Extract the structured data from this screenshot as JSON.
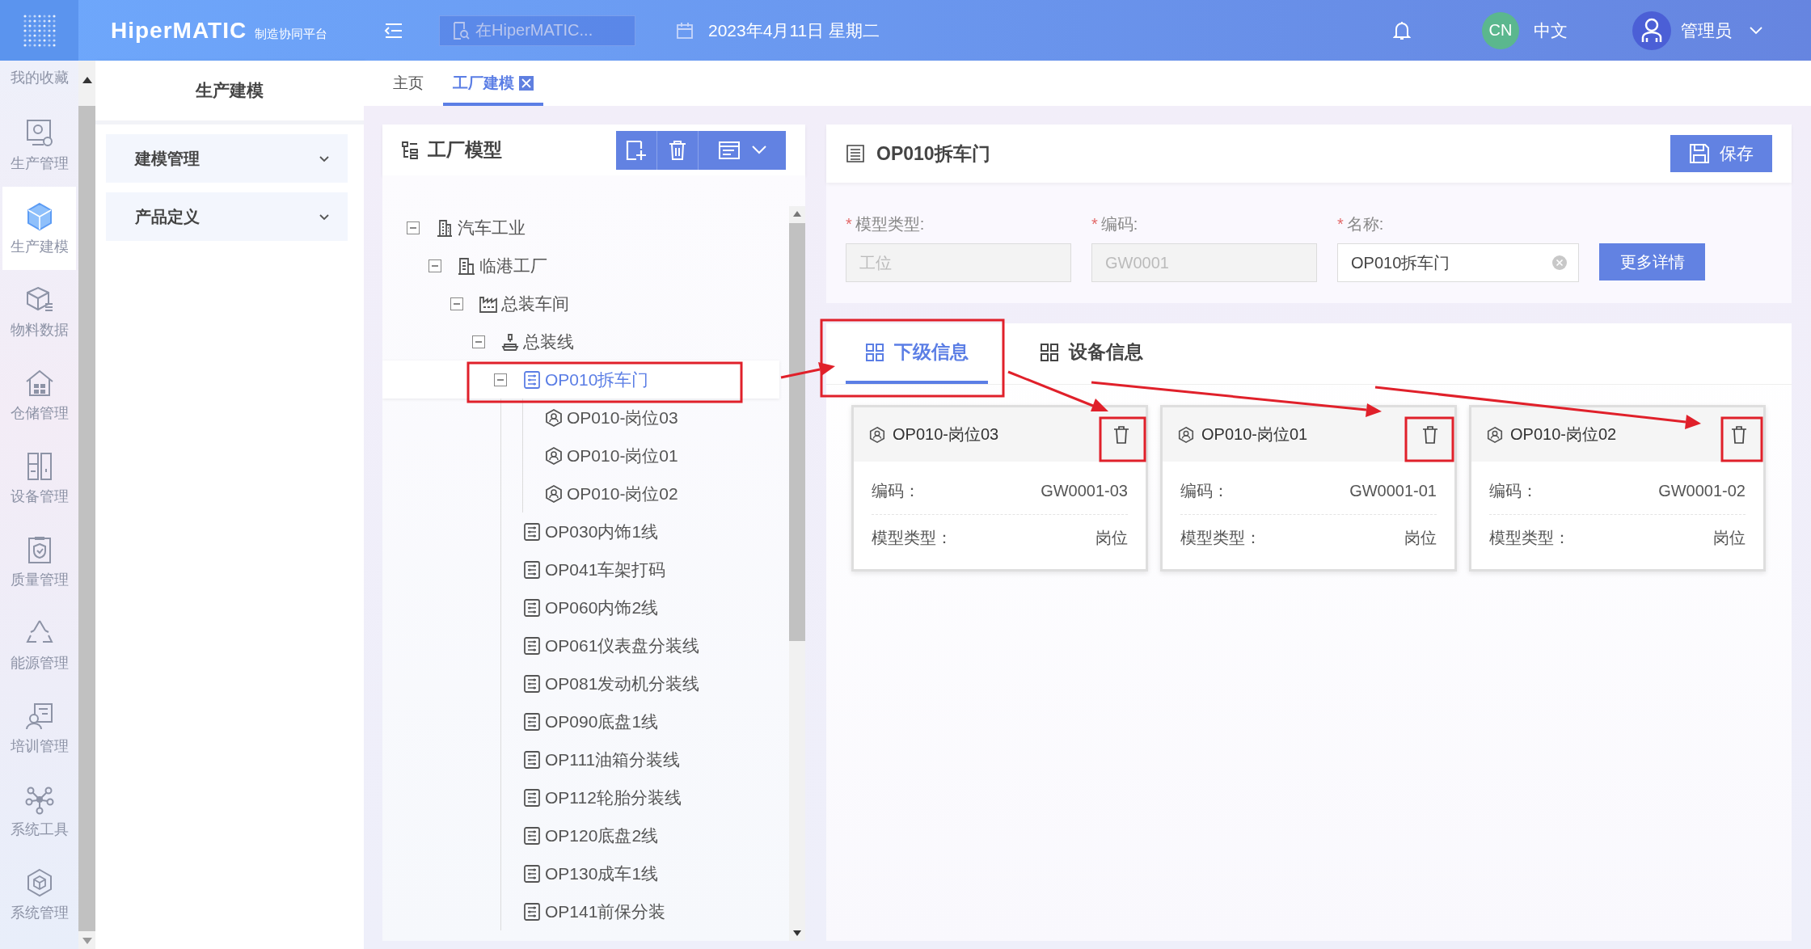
{
  "header": {
    "brand": "HiperMATIC",
    "brand_subtitle": "制造协同平台",
    "search": {
      "placeholder": "在HiperMATIC..."
    },
    "date": "2023年4月11日 星期二",
    "language_badge": "CN",
    "language": "中文",
    "user": "管理员"
  },
  "nav_rail": [
    {
      "label": "我的收藏",
      "kind": "favorites",
      "selected": false
    },
    {
      "label": "生产管理",
      "kind": "production",
      "selected": false
    },
    {
      "label": "生产建模",
      "kind": "modeling",
      "selected": true
    },
    {
      "label": "物料数据",
      "kind": "material",
      "selected": false
    },
    {
      "label": "仓储管理",
      "kind": "warehouse",
      "selected": false
    },
    {
      "label": "设备管理",
      "kind": "equipment",
      "selected": false
    },
    {
      "label": "质量管理",
      "kind": "quality",
      "selected": false
    },
    {
      "label": "能源管理",
      "kind": "energy",
      "selected": false
    },
    {
      "label": "培训管理",
      "kind": "training",
      "selected": false
    },
    {
      "label": "系统工具",
      "kind": "tools",
      "selected": false
    },
    {
      "label": "系统管理",
      "kind": "system",
      "selected": false
    }
  ],
  "module_sidebar": {
    "title": "生产建模",
    "sections": [
      {
        "label": "建模管理",
        "expanded": false
      },
      {
        "label": "产品定义",
        "expanded": false
      }
    ]
  },
  "page_tabs": [
    {
      "label": "主页",
      "selected": false,
      "closable": false
    },
    {
      "label": "工厂建模",
      "selected": true,
      "closable": true
    }
  ],
  "tree_panel": {
    "title": "工厂模型",
    "nodes": [
      {
        "label": "汽车工业",
        "kind": "industry",
        "selected": false,
        "expanded": true,
        "children": [
          {
            "label": "临港工厂",
            "kind": "plant",
            "selected": false,
            "expanded": true,
            "children": [
              {
                "label": "总装车间",
                "kind": "workshop",
                "selected": false,
                "expanded": true,
                "children": [
                  {
                    "label": "总装线",
                    "kind": "line",
                    "selected": false,
                    "expanded": true,
                    "children": [
                      {
                        "label": "OP010拆车门",
                        "kind": "station",
                        "selected": true,
                        "expanded": true,
                        "children": [
                          {
                            "label": "OP010-岗位03",
                            "kind": "position",
                            "selected": false
                          },
                          {
                            "label": "OP010-岗位01",
                            "kind": "position",
                            "selected": false
                          },
                          {
                            "label": "OP010-岗位02",
                            "kind": "position",
                            "selected": false
                          }
                        ]
                      },
                      {
                        "label": "OP030内饰1线",
                        "kind": "station",
                        "selected": false
                      },
                      {
                        "label": "OP041车架打码",
                        "kind": "station",
                        "selected": false
                      },
                      {
                        "label": "OP060内饰2线",
                        "kind": "station",
                        "selected": false
                      },
                      {
                        "label": "OP061仪表盘分装线",
                        "kind": "station",
                        "selected": false
                      },
                      {
                        "label": "OP081发动机分装线",
                        "kind": "station",
                        "selected": false
                      },
                      {
                        "label": "OP090底盘1线",
                        "kind": "station",
                        "selected": false
                      },
                      {
                        "label": "OP111油箱分装线",
                        "kind": "station",
                        "selected": false
                      },
                      {
                        "label": "OP112轮胎分装线",
                        "kind": "station",
                        "selected": false
                      },
                      {
                        "label": "OP120底盘2线",
                        "kind": "station",
                        "selected": false
                      },
                      {
                        "label": "OP130成车1线",
                        "kind": "station",
                        "selected": false
                      },
                      {
                        "label": "OP141前保分装",
                        "kind": "station",
                        "selected": false
                      }
                    ]
                  }
                ]
              }
            ]
          }
        ]
      }
    ]
  },
  "detail": {
    "title": "OP010拆车门",
    "save_label": "保存",
    "fields": [
      {
        "required": true,
        "required_mark": "*",
        "label": "模型类型:",
        "value": "工位",
        "disabled": true,
        "clearable": false
      },
      {
        "required": true,
        "required_mark": "*",
        "label": "编码:",
        "value": "GW0001",
        "disabled": true,
        "clearable": false
      },
      {
        "required": true,
        "required_mark": "*",
        "label": "名称:",
        "value": "OP010拆车门",
        "disabled": false,
        "clearable": true
      }
    ],
    "more_button": "更多详情",
    "tabs": [
      {
        "label": "下级信息",
        "selected": true
      },
      {
        "label": "设备信息",
        "selected": false
      }
    ],
    "cards": [
      {
        "title": "OP010-岗位03",
        "rows": [
          {
            "label": "编码：",
            "value": "GW0001-03"
          },
          {
            "label": "模型类型：",
            "value": "岗位"
          }
        ]
      },
      {
        "title": "OP010-岗位01",
        "rows": [
          {
            "label": "编码：",
            "value": "GW0001-01"
          },
          {
            "label": "模型类型：",
            "value": "岗位"
          }
        ]
      },
      {
        "title": "OP010-岗位02",
        "rows": [
          {
            "label": "编码：",
            "value": "GW0001-02"
          },
          {
            "label": "模型类型：",
            "value": "岗位"
          }
        ]
      }
    ]
  }
}
